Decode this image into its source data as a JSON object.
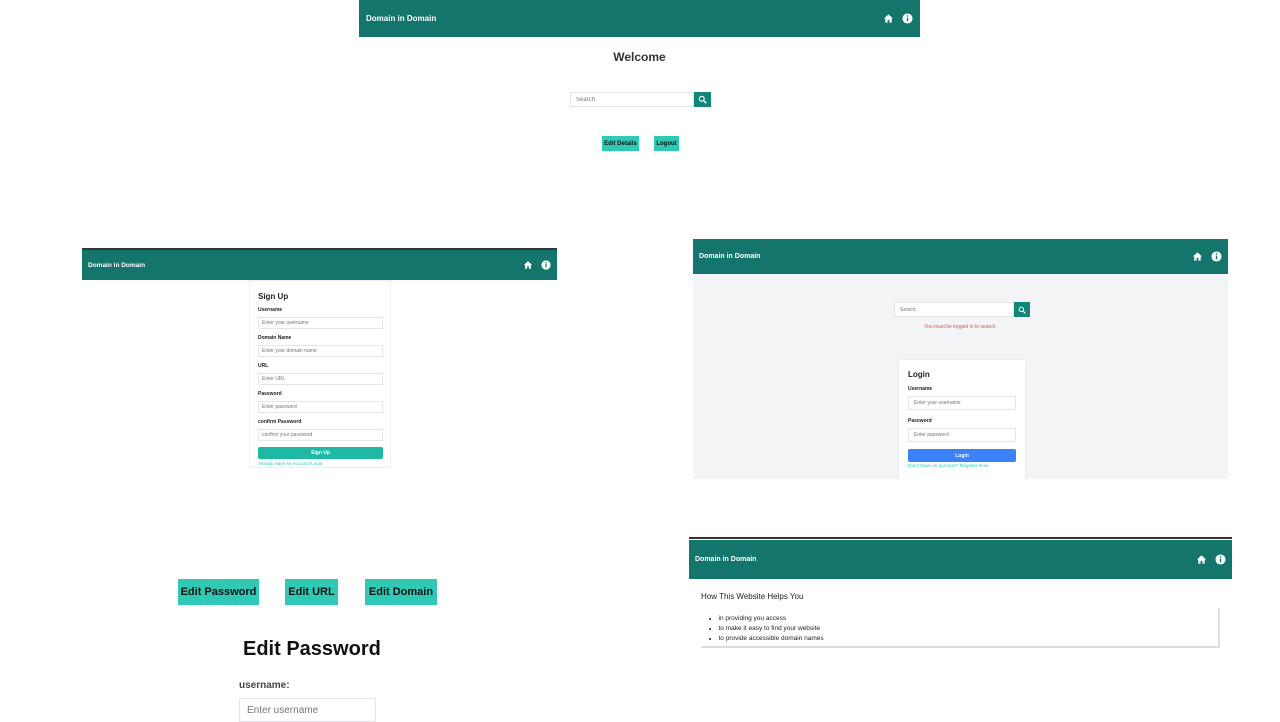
{
  "app": {
    "brand": "Domain in Domain"
  },
  "home": {
    "welcome": "Welcome",
    "search_placeholder": "Search",
    "edit_details": "Edit Details",
    "logout": "Logout"
  },
  "signup": {
    "title": "Sign Up",
    "username_label": "Username",
    "username_placeholder": "Enter your username",
    "domain_label": "Domain Name",
    "domain_placeholder": "Enter your domain name",
    "url_label": "URL",
    "url_placeholder": "Enter URL",
    "password_label": "Password",
    "password_placeholder": "Enter password",
    "confirm_label": "confirm Password",
    "confirm_placeholder": "confirm your password",
    "submit": "Sign Up",
    "login_link": "Already Have An Account?Login"
  },
  "login_page": {
    "search_placeholder": "Search",
    "error": "You must be logged in to search.",
    "title": "Login",
    "username_label": "Username",
    "username_placeholder": "Enter your username",
    "password_label": "Password",
    "password_placeholder": "Enter password",
    "submit": "Login",
    "register_link": "Don't have an account? Register Now"
  },
  "edit": {
    "tabs": [
      "Edit Password",
      "Edit URL",
      "Edit Domain"
    ],
    "title": "Edit Password",
    "username_label": "username:",
    "username_placeholder": "Enter username"
  },
  "about": {
    "title": "How This Website Helps You",
    "items": [
      "in providing you access",
      "to make it easy to find your website",
      "to provide accessible domain names"
    ]
  },
  "colors": {
    "header": "#13756b",
    "accent": "#2fc9b6",
    "search_button": "#13857a",
    "login_button": "#3b82f6",
    "error": "#e05252",
    "link": "#2fc9b6"
  },
  "icons": {
    "home": "home-icon",
    "info": "info-icon",
    "search": "search-icon"
  }
}
